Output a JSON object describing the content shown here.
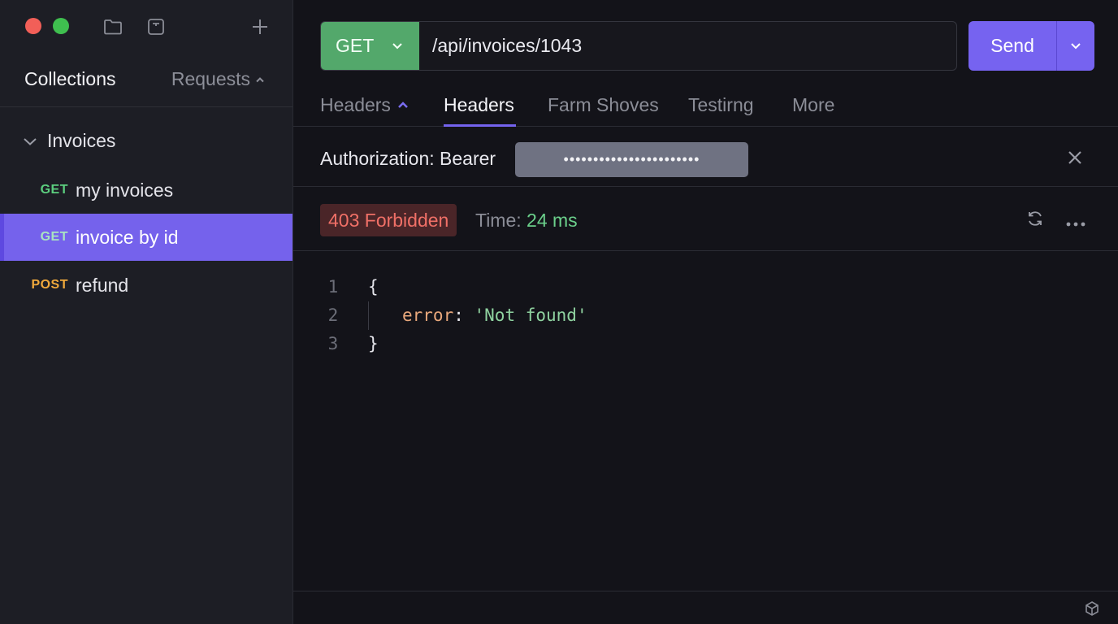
{
  "sidebar": {
    "tabs": {
      "collections": "Collections",
      "requests": "Requests"
    },
    "folder": {
      "name": "Invoices"
    },
    "requests": [
      {
        "method": "GET",
        "name": "my invoices",
        "selected": false
      },
      {
        "method": "GET",
        "name": "invoice by id",
        "selected": true
      },
      {
        "method": "POST",
        "name": "refund",
        "selected": false
      }
    ]
  },
  "request": {
    "method": "GET",
    "url": "/api/invoices/1043",
    "send_label": "Send"
  },
  "tabs": [
    "Headers",
    "Headers",
    "Farm Shoves",
    "Testirng",
    "More"
  ],
  "auth": {
    "label": "Authorization: Bearer",
    "token": "•••••••••••••••••••••••"
  },
  "response": {
    "status": "403 Forbidden",
    "time_label": "Time:",
    "time_value": "24 ms",
    "body_lines": [
      {
        "num": "1",
        "text": "{"
      },
      {
        "num": "2",
        "key": "error",
        "value": "'Not found'"
      },
      {
        "num": "3",
        "text": "}"
      }
    ]
  },
  "colors": {
    "accent": "#7663f0",
    "get": "#5ccf7f",
    "post": "#f0a93c",
    "error": "#f07067",
    "success": "#6bd08b"
  }
}
